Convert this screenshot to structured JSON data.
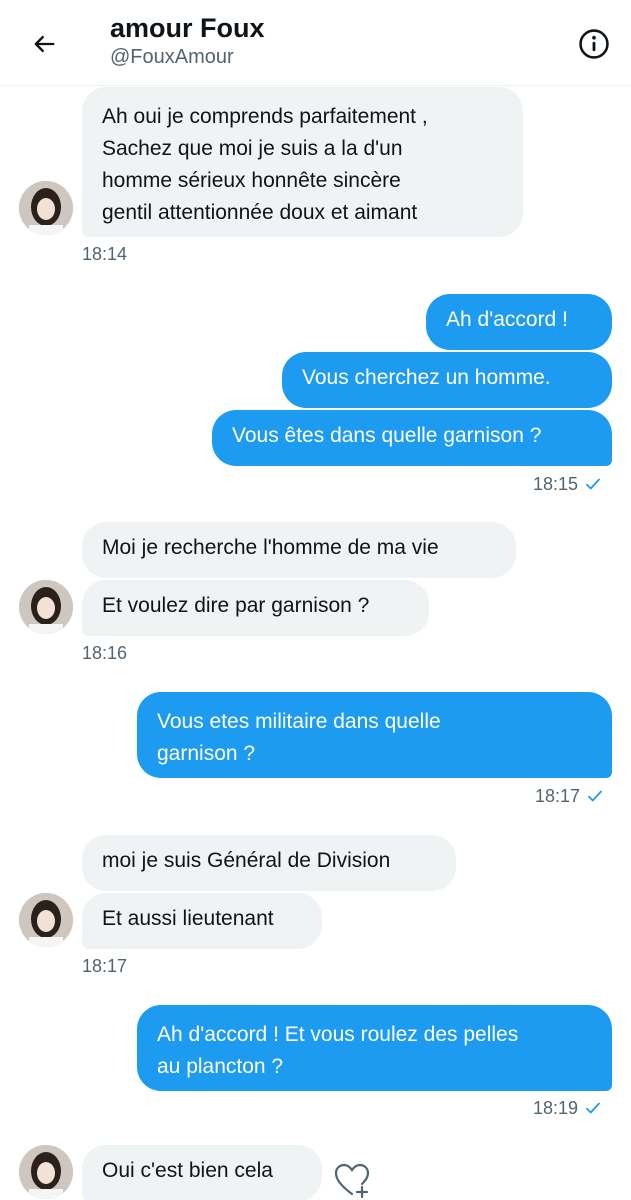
{
  "header": {
    "name": "amour Foux",
    "handle": "@FouxAmour"
  },
  "icons": {
    "back": "arrow-left-icon",
    "info": "info-icon",
    "read": "checkmark-icon",
    "react": "heart-plus-icon"
  },
  "colors": {
    "accent": "#1d9bf0",
    "incoming_bubble": "#eff3f4",
    "muted_text": "#536471"
  },
  "messages": [
    {
      "from": "them",
      "text": "Ah oui je comprends parfaitement ,\nSachez que moi je suis a la d'un\nhomme sérieux honnête sincère\ngentil attentionnée doux et aimant"
    },
    {
      "from": "them",
      "time": "18:14"
    },
    {
      "from": "me",
      "text": "Ah d'accord !"
    },
    {
      "from": "me",
      "text": "Vous cherchez un homme."
    },
    {
      "from": "me",
      "text": "Vous êtes dans quelle garnison ?"
    },
    {
      "from": "me",
      "time": "18:15"
    },
    {
      "from": "them",
      "text": "Moi je recherche l'homme de ma vie"
    },
    {
      "from": "them",
      "text": "Et voulez dire par garnison ?"
    },
    {
      "from": "them",
      "time": "18:16"
    },
    {
      "from": "me",
      "text": "Vous etes militaire dans quelle\ngarnison ?"
    },
    {
      "from": "me",
      "time": "18:17"
    },
    {
      "from": "them",
      "text": "moi je suis Général de Division"
    },
    {
      "from": "them",
      "text": "Et aussi lieutenant"
    },
    {
      "from": "them",
      "time": "18:17"
    },
    {
      "from": "me",
      "text": "Ah d'accord ! Et vous roulez des pelles\nau plancton ?"
    },
    {
      "from": "me",
      "time": "18:19"
    },
    {
      "from": "them",
      "text": "Oui c'est bien cela"
    }
  ]
}
